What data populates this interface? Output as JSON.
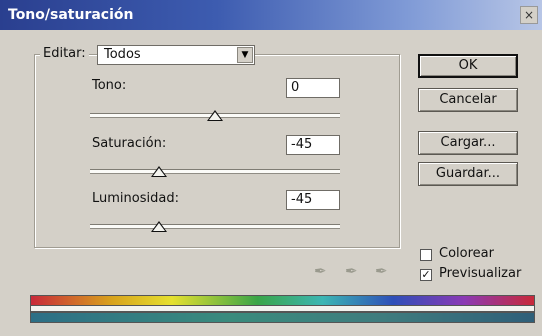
{
  "window": {
    "title": "Tono/saturación",
    "close_label": "×"
  },
  "edit": {
    "label": "Editar:",
    "value": "Todos",
    "arrow": "▼"
  },
  "sliders": [
    {
      "name": "tono",
      "label": "Tono:",
      "value": "0",
      "position": 0.5
    },
    {
      "name": "saturacion",
      "label": "Saturación:",
      "value": "-45",
      "position": 0.275
    },
    {
      "name": "luminosidad",
      "label": "Luminosidad:",
      "value": "-45",
      "position": 0.275
    }
  ],
  "buttons": {
    "ok": "OK",
    "cancel": "Cancelar",
    "load": "Cargar...",
    "save": "Guardar..."
  },
  "options": [
    {
      "label": "Colorear",
      "checked": false,
      "mark": ""
    },
    {
      "label": "Previsualizar",
      "checked": true,
      "mark": "✓"
    }
  ],
  "icons": [
    "eyedropper-icon",
    "eyedropper-plus-icon",
    "eyedropper-minus-icon"
  ],
  "glyphs": {
    "eyedropper": "✒"
  }
}
